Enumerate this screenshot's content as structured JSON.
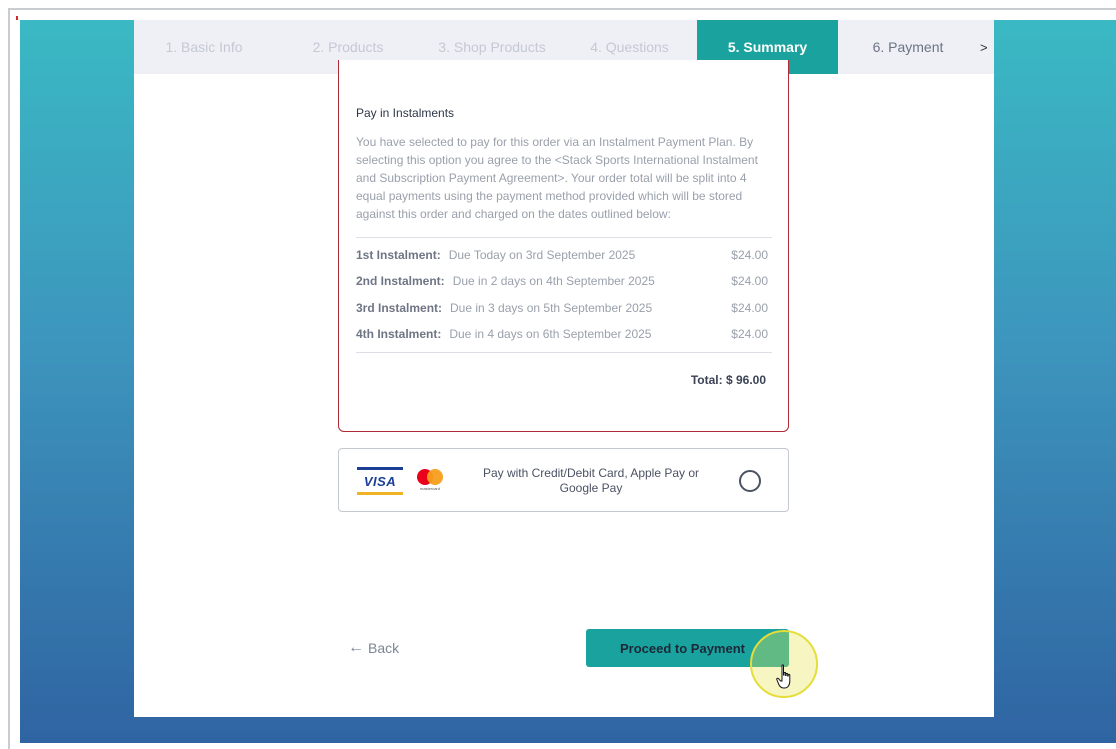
{
  "steps": [
    {
      "label": "1. Basic Info"
    },
    {
      "label": "2. Products"
    },
    {
      "label": "3. Shop Products"
    },
    {
      "label": "4. Questions"
    },
    {
      "label": "5. Summary"
    },
    {
      "label": "6. Payment"
    }
  ],
  "steps_more": ">",
  "instalments": {
    "title": "Pay in Instalments",
    "description": "You have selected to pay for this order via an Instalment Payment Plan. By selecting this option you agree to the <Stack Sports International Instalment and Subscription Payment Agreement>. Your order total will be split into 4 equal payments using the payment method provided which will be stored against this order and charged on the dates outlined below:",
    "rows": [
      {
        "label": "1st Instalment:",
        "due": "Due Today on 3rd September 2025",
        "amount": "$24.00"
      },
      {
        "label": "2nd Instalment:",
        "due": "Due in 2 days on 4th September 2025",
        "amount": "$24.00"
      },
      {
        "label": "3rd Instalment:",
        "due": "Due in 3 days on 5th September 2025",
        "amount": "$24.00"
      },
      {
        "label": "4th Instalment:",
        "due": "Due in 4 days on 6th September 2025",
        "amount": "$24.00"
      }
    ],
    "total": "Total: $ 96.00"
  },
  "payment_option": {
    "visa_text": "VISA",
    "mastercard_text": "mastercard",
    "label": "Pay with Credit/Debit Card, Apple Pay or Google Pay",
    "selected": false
  },
  "nav": {
    "back_arrow": "←",
    "back_label": "Back",
    "proceed_label": "Proceed to Payment"
  },
  "colors": {
    "accent": "#1aa39e",
    "card_border": "#b02a35"
  },
  "icons": {
    "back": "arrow-left-icon",
    "cursor": "hand-pointer-icon"
  }
}
